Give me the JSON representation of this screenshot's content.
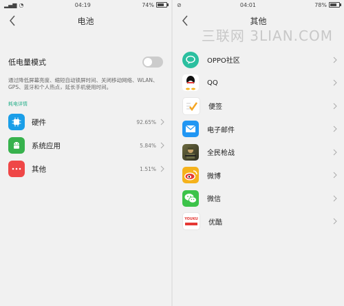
{
  "left": {
    "status": {
      "time": "04:19",
      "battery": "74%",
      "battery_level": 0.74
    },
    "title": "电池",
    "low_power": {
      "label": "低电量模式",
      "enabled": false
    },
    "description": "通过降低屏幕亮度、缩短自动锁屏时间、关闭移动网络、WLAN、GPS、蓝牙和个人热点，延长手机使用时间。",
    "section_title": "耗电详情",
    "usage": [
      {
        "name": "硬件",
        "percent": "92.65%",
        "icon": "chip-icon",
        "color": "#1a9ee8"
      },
      {
        "name": "系统应用",
        "percent": "5.84%",
        "icon": "android-icon",
        "color": "#37b24d"
      },
      {
        "name": "其他",
        "percent": "1.51%",
        "icon": "more-dots-icon",
        "color": "#ef4747"
      }
    ]
  },
  "right": {
    "status": {
      "time": "04:01",
      "battery": "78%",
      "battery_level": 0.78
    },
    "title": "其他",
    "watermark": "三联网 3LIAN.COM",
    "apps": [
      {
        "name": "OPPO社区",
        "icon": "oppo-community-icon",
        "color": "#2bbf9f"
      },
      {
        "name": "QQ",
        "icon": "qq-penguin-icon",
        "color": "#ffffff"
      },
      {
        "name": "便签",
        "icon": "notes-check-icon",
        "color": "#ffffff"
      },
      {
        "name": "电子邮件",
        "icon": "mail-icon",
        "color": "#2196f3"
      },
      {
        "name": "全民枪战",
        "icon": "game-soldier-icon",
        "color": "#5b5b3a"
      },
      {
        "name": "微博",
        "icon": "weibo-icon",
        "color": "#f5b21c"
      },
      {
        "name": "微信",
        "icon": "wechat-icon",
        "color": "#3cc34a"
      },
      {
        "name": "优酷",
        "icon": "youku-icon",
        "color": "#ffffff",
        "logo_text": "YOUKU"
      }
    ]
  }
}
